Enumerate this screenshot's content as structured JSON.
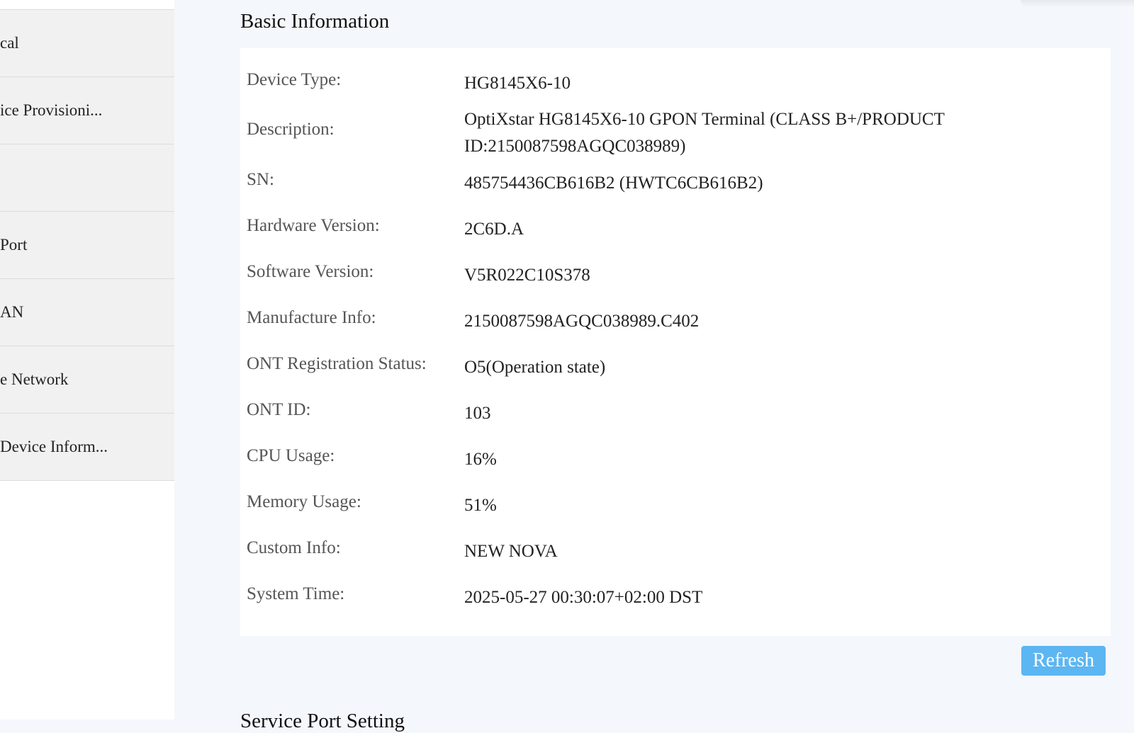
{
  "sidebar": {
    "items": [
      {
        "label": "cal"
      },
      {
        "label": "ice Provisioni..."
      },
      {
        "label": ""
      },
      {
        "label": "Port"
      },
      {
        "label": "AN"
      },
      {
        "label": "e Network"
      },
      {
        "label": "Device Inform..."
      }
    ]
  },
  "basic_info": {
    "title": "Basic Information",
    "rows": [
      {
        "label": "Device Type:",
        "value": "HG8145X6-10"
      },
      {
        "label": "Description:",
        "value": "OptiXstar HG8145X6-10 GPON Terminal (CLASS B+/PRODUCT ID:2150087598AGQC038989)"
      },
      {
        "label": "SN:",
        "value": "485754436CB616B2 (HWTC6CB616B2)"
      },
      {
        "label": "Hardware Version:",
        "value": "2C6D.A"
      },
      {
        "label": "Software Version:",
        "value": "V5R022C10S378"
      },
      {
        "label": "Manufacture Info:",
        "value": "2150087598AGQC038989.C402"
      },
      {
        "label": "ONT Registration Status:",
        "value": "O5(Operation state)"
      },
      {
        "label": "ONT ID:",
        "value": "103"
      },
      {
        "label": "CPU Usage:",
        "value": "16%"
      },
      {
        "label": "Memory Usage:",
        "value": "51%"
      },
      {
        "label": "Custom Info:",
        "value": "NEW NOVA"
      },
      {
        "label": "System Time:",
        "value": "2025-05-27 00:30:07+02:00 DST"
      }
    ],
    "refresh_label": "Refresh"
  },
  "next_section": {
    "title": "Service Port Setting"
  },
  "colors": {
    "accent": "#5cb6f2",
    "background": "#f4f7fb",
    "sidebar": "#f1f1f1"
  }
}
